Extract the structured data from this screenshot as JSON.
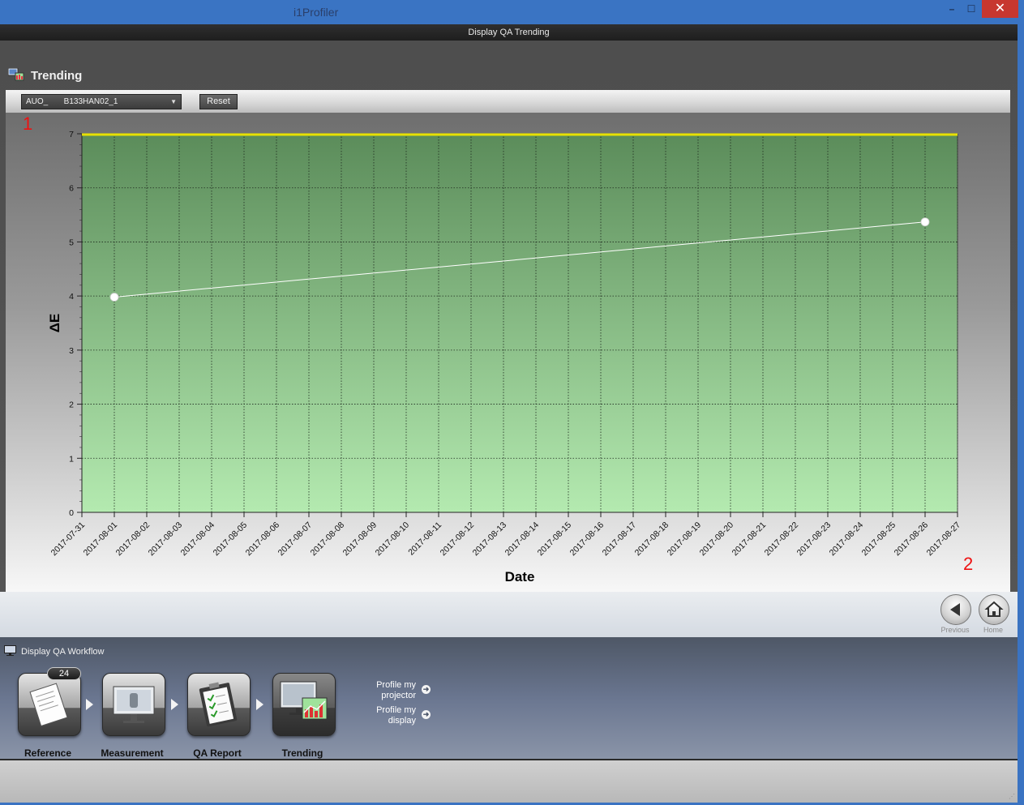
{
  "window": {
    "title": "i1Profiler",
    "min_glyph": "–",
    "max_glyph": "☐",
    "close_glyph": "✕"
  },
  "page": {
    "subtitle": "Display QA Trending",
    "heading": "Trending"
  },
  "toolbar": {
    "display_select_value": "AUO_       B133HAN02_1",
    "reset_label": "Reset"
  },
  "annotations": {
    "marker_1": "1",
    "marker_2": "2"
  },
  "chart_data": {
    "type": "line",
    "xlabel": "Date",
    "ylabel": "ΔE",
    "ylim": [
      0,
      7
    ],
    "yticks": [
      "0",
      "1",
      "2",
      "3",
      "4",
      "5",
      "6",
      "7"
    ],
    "x_ticks": [
      "2017-07-31",
      "2017-08-01",
      "2017-08-02",
      "2017-08-03",
      "2017-08-04",
      "2017-08-05",
      "2017-08-06",
      "2017-08-07",
      "2017-08-08",
      "2017-08-09",
      "2017-08-10",
      "2017-08-11",
      "2017-08-12",
      "2017-08-13",
      "2017-08-14",
      "2017-08-15",
      "2017-08-16",
      "2017-08-17",
      "2017-08-18",
      "2017-08-19",
      "2017-08-20",
      "2017-08-21",
      "2017-08-22",
      "2017-08-23",
      "2017-08-24",
      "2017-08-25",
      "2017-08-26",
      "2017-08-27"
    ],
    "series": [
      {
        "x": [
          "2017-08-01",
          "2017-08-26"
        ],
        "y": [
          3.98,
          5.37
        ],
        "color": "#ffffff"
      }
    ],
    "threshold": {
      "y": 7,
      "color": "#e6e000"
    },
    "grid": true,
    "background_colors": [
      "#5b8c5a",
      "#b4eab0"
    ]
  },
  "nav": {
    "previous_label": "Previous",
    "home_label": "Home"
  },
  "workflow": {
    "title": "Display QA Workflow",
    "badge_count": "24",
    "steps": [
      {
        "label": "Reference"
      },
      {
        "label": "Measurement"
      },
      {
        "label": "QA Report"
      },
      {
        "label": "Trending"
      }
    ],
    "links": [
      {
        "label_line1": "Profile my",
        "label_line2": "projector"
      },
      {
        "label_line1": "Profile my",
        "label_line2": "display"
      }
    ]
  }
}
